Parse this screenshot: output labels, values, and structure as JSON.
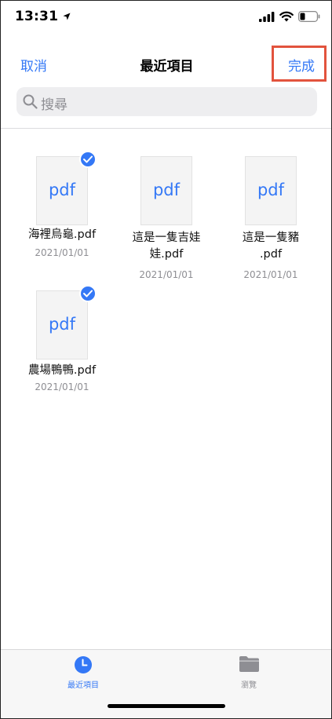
{
  "status_bar": {
    "time": "13:31"
  },
  "nav": {
    "cancel_label": "取消",
    "title": "最近項目",
    "done_label": "完成"
  },
  "search": {
    "placeholder": "搜尋"
  },
  "files": [
    {
      "ext": "pdf",
      "name_lines": [
        "海裡烏龜.pdf",
        ""
      ],
      "date": "2021/01/01",
      "selected": true
    },
    {
      "ext": "pdf",
      "name_lines": [
        "這是一隻吉娃",
        "娃.pdf"
      ],
      "date": "2021/01/01",
      "selected": false
    },
    {
      "ext": "pdf",
      "name_lines": [
        "這是一隻豬",
        ".pdf"
      ],
      "date": "2021/01/01",
      "selected": false
    },
    {
      "ext": "pdf",
      "name_lines": [
        "農場鴨鴨.pdf",
        ""
      ],
      "date": "2021/01/01",
      "selected": true
    }
  ],
  "tabs": [
    {
      "label": "最近項目",
      "active": true,
      "icon": "clock-icon"
    },
    {
      "label": "瀏覽",
      "active": false,
      "icon": "folder-icon"
    }
  ],
  "colors": {
    "accent": "#3478f6",
    "highlight_box": "#e2533d",
    "inactive": "#8e8e93"
  }
}
